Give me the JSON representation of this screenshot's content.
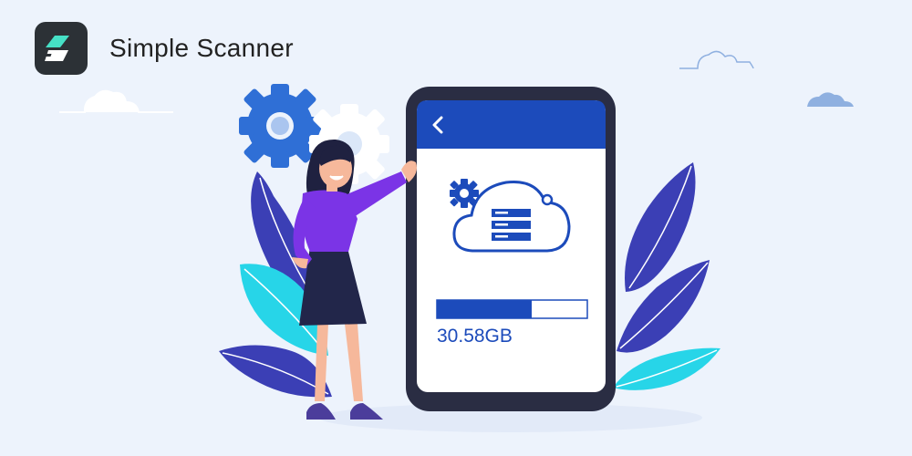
{
  "app": {
    "name": "Simple Scanner",
    "icon": "scanner-icon"
  },
  "storage": {
    "used_label": "30.58GB",
    "progress_fraction": 0.63
  },
  "colors": {
    "background": "#edf3fc",
    "accent": "#1c4bbb",
    "gear_blue": "#2f6fd6",
    "leaf_dark": "#3b3fb5",
    "leaf_cyan": "#27d5e8",
    "phone_frame": "#2a2d43"
  }
}
